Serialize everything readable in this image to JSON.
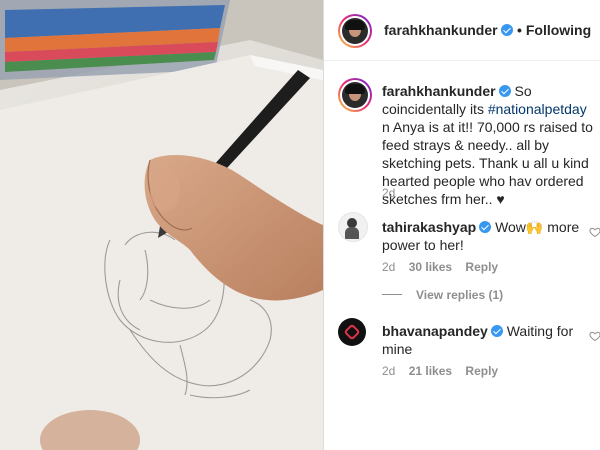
{
  "post": {
    "author": "farahkhankunder",
    "follow_status": "• Following",
    "caption": {
      "username": "farahkhankunder",
      "text_before": "So coincidentally its ",
      "hashtag": "#nationalpetday",
      "text_after": " n Anya is at it!! 70,000 rs raised to feed strays & needy.. all by sketching pets. Thank u all u kind hearted people who hav ordered sketches frm her.. ♥",
      "age": "2d"
    }
  },
  "comments": [
    {
      "username": "tahirakashyap",
      "text": "Wow🙌 more power to her!",
      "age": "2d",
      "likes": "30 likes",
      "reply": "Reply",
      "view_replies": "View replies (1)"
    },
    {
      "username": "bhavanapandey",
      "text": "Waiting for mine",
      "age": "2d",
      "likes": "21 likes",
      "reply": "Reply"
    }
  ],
  "colors": {
    "verified": "#3897f0",
    "hashtag": "#00376b",
    "meta_gray": "#8e8e8e"
  },
  "icons": [
    "verified-badge-icon",
    "heart-icon"
  ]
}
